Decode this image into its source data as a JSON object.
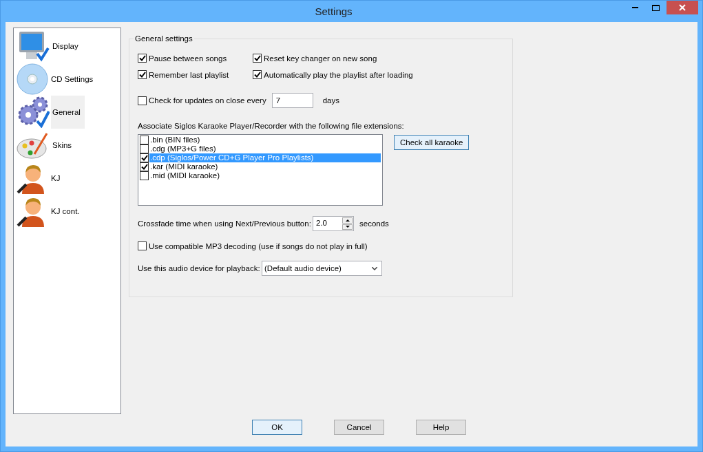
{
  "window": {
    "title": "Settings"
  },
  "sidebar": {
    "items": [
      {
        "label": "Display",
        "kind": "monitor",
        "selected": false
      },
      {
        "label": "CD Settings",
        "kind": "disc",
        "selected": false
      },
      {
        "label": "General",
        "kind": "gears",
        "selected": true
      },
      {
        "label": "Skins",
        "kind": "palette",
        "selected": false
      },
      {
        "label": "KJ",
        "kind": "singer",
        "selected": false
      },
      {
        "label": "KJ cont.",
        "kind": "singer",
        "selected": false
      }
    ]
  },
  "general_settings": {
    "title": "General settings",
    "options": [
      {
        "label": "Pause between songs",
        "checked": true
      },
      {
        "label": "Reset key changer on new song",
        "checked": true
      },
      {
        "label": "Remember last playlist",
        "checked": true
      },
      {
        "label": "Automatically play the playlist after loading",
        "checked": true
      }
    ],
    "update_check": {
      "label": "Check for updates on close every",
      "checked": false,
      "value": "7",
      "unit": "days"
    },
    "associate_label": "Associate Siglos Karaoke Player/Recorder with the following file extensions:",
    "extensions": [
      {
        "label": ".bin (BIN files)",
        "checked": false,
        "selected": false
      },
      {
        "label": ".cdg (MP3+G files)",
        "checked": false,
        "selected": false
      },
      {
        "label": ".cdp (Siglos/Power CD+G Player Pro Playlists)",
        "checked": true,
        "selected": true
      },
      {
        "label": ".kar (MIDI karaoke)",
        "checked": true,
        "selected": false
      },
      {
        "label": ".mid (MIDI karaoke)",
        "checked": false,
        "selected": false
      }
    ],
    "check_all_button": "Check all karaoke",
    "crossfade": {
      "label": "Crossfade time when using Next/Previous button:",
      "value": "2.0",
      "unit": "seconds"
    },
    "mp3_decoding": {
      "label": "Use compatible MP3 decoding (use if songs do not play in full)",
      "checked": false
    },
    "audio_device": {
      "label": "Use this audio device for playback:",
      "value": "(Default audio device)"
    }
  },
  "buttons": [
    "OK",
    "Cancel",
    "Help"
  ]
}
